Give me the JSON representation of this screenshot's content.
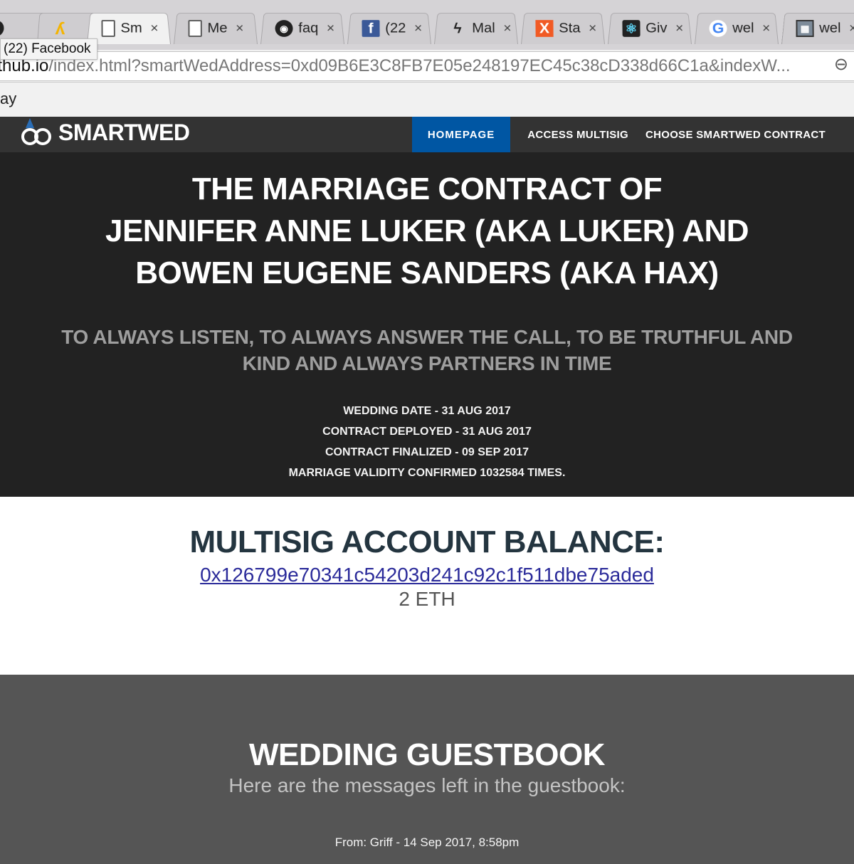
{
  "browser": {
    "tabs": [
      {
        "icon": "github-icon",
        "glyph": "◉",
        "title": "",
        "active": false
      },
      {
        "icon": "ribbon-icon",
        "glyph": "ʎ",
        "title": "",
        "active": false
      },
      {
        "icon": "document-icon",
        "glyph": "",
        "title": "Sm",
        "active": true
      },
      {
        "icon": "document-icon",
        "glyph": "",
        "title": "Me",
        "active": false
      },
      {
        "icon": "github-icon",
        "glyph": "◉",
        "title": "faq",
        "active": false
      },
      {
        "icon": "facebook-icon",
        "glyph": "f",
        "title": "(22",
        "active": false
      },
      {
        "icon": "signature-icon",
        "glyph": "ϟ",
        "title": "Mal",
        "active": false
      },
      {
        "icon": "x-logo-icon",
        "glyph": "X",
        "title": "Sta",
        "active": false
      },
      {
        "icon": "react-icon",
        "glyph": "⚛",
        "title": "Giv",
        "active": false
      },
      {
        "icon": "google-icon",
        "glyph": "G",
        "title": "wel",
        "active": false
      },
      {
        "icon": "grid-icon",
        "glyph": "▦",
        "title": "wel",
        "active": false
      }
    ],
    "close_glyph": "×",
    "tooltip": "(22) Facebook",
    "url_host": "ithub.io",
    "url_path": "/index.html?smartWedAddress=0xd09B6E3C8FB7E05e248197EC45c38cD338d66C1a&indexW...",
    "zoom_glyph": "⊖",
    "bookmark_fragment": "ay"
  },
  "site": {
    "brand": "SMARTWED",
    "nav": [
      {
        "label": "HOMEPAGE",
        "active": true
      },
      {
        "label": "ACCESS MULTISIG",
        "active": false
      },
      {
        "label": "CHOOSE SMARTWED CONTRACT",
        "active": false
      }
    ]
  },
  "hero": {
    "title_lines": [
      "THE MARRIAGE CONTRACT OF",
      "JENNIFER ANNE LUKER (AKA LUKER) AND",
      "BOWEN EUGENE SANDERS (AKA HAX)"
    ],
    "vow": "TO ALWAYS LISTEN, TO ALWAYS ANSWER THE CALL, TO BE TRUTHFUL AND KIND AND ALWAYS PARTNERS IN TIME",
    "facts": [
      "WEDDING DATE - 31 AUG 2017",
      "CONTRACT DEPLOYED - 31 AUG 2017",
      "CONTRACT FINALIZED - 09 SEP 2017",
      "MARRIAGE VALIDITY CONFIRMED 1032584 TIMES."
    ]
  },
  "balance": {
    "heading": "MULTISIG ACCOUNT BALANCE:",
    "address": "0x126799e70341c54203d241c92c1f511dbe75aded",
    "amount": "2 ETH"
  },
  "guestbook": {
    "heading": "WEDDING GUESTBOOK",
    "subheading": "Here are the messages left in the guestbook:",
    "entries": [
      {
        "from": "From: Griff - 14 Sep 2017, 8:58pm"
      }
    ]
  }
}
